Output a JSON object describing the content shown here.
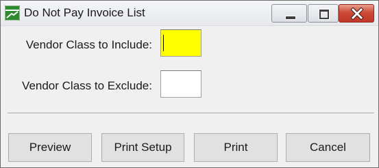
{
  "window": {
    "title": "Do Not Pay Invoice List",
    "icon": "green-chart-app-icon",
    "controls": {
      "minimize": "minimize-icon",
      "maximize": "maximize-icon",
      "close": "close-icon"
    }
  },
  "form": {
    "include": {
      "label": "Vendor Class to Include:",
      "value": "",
      "focused": true,
      "highlight_color": "#ffff00"
    },
    "exclude": {
      "label": "Vendor Class to Exclude:",
      "value": ""
    }
  },
  "buttons": {
    "preview": "Preview",
    "print_setup": "Print Setup",
    "print": "Print",
    "cancel": "Cancel"
  },
  "colors": {
    "close_button": "#c0382a",
    "dialog_background": "#f0f0f0"
  }
}
